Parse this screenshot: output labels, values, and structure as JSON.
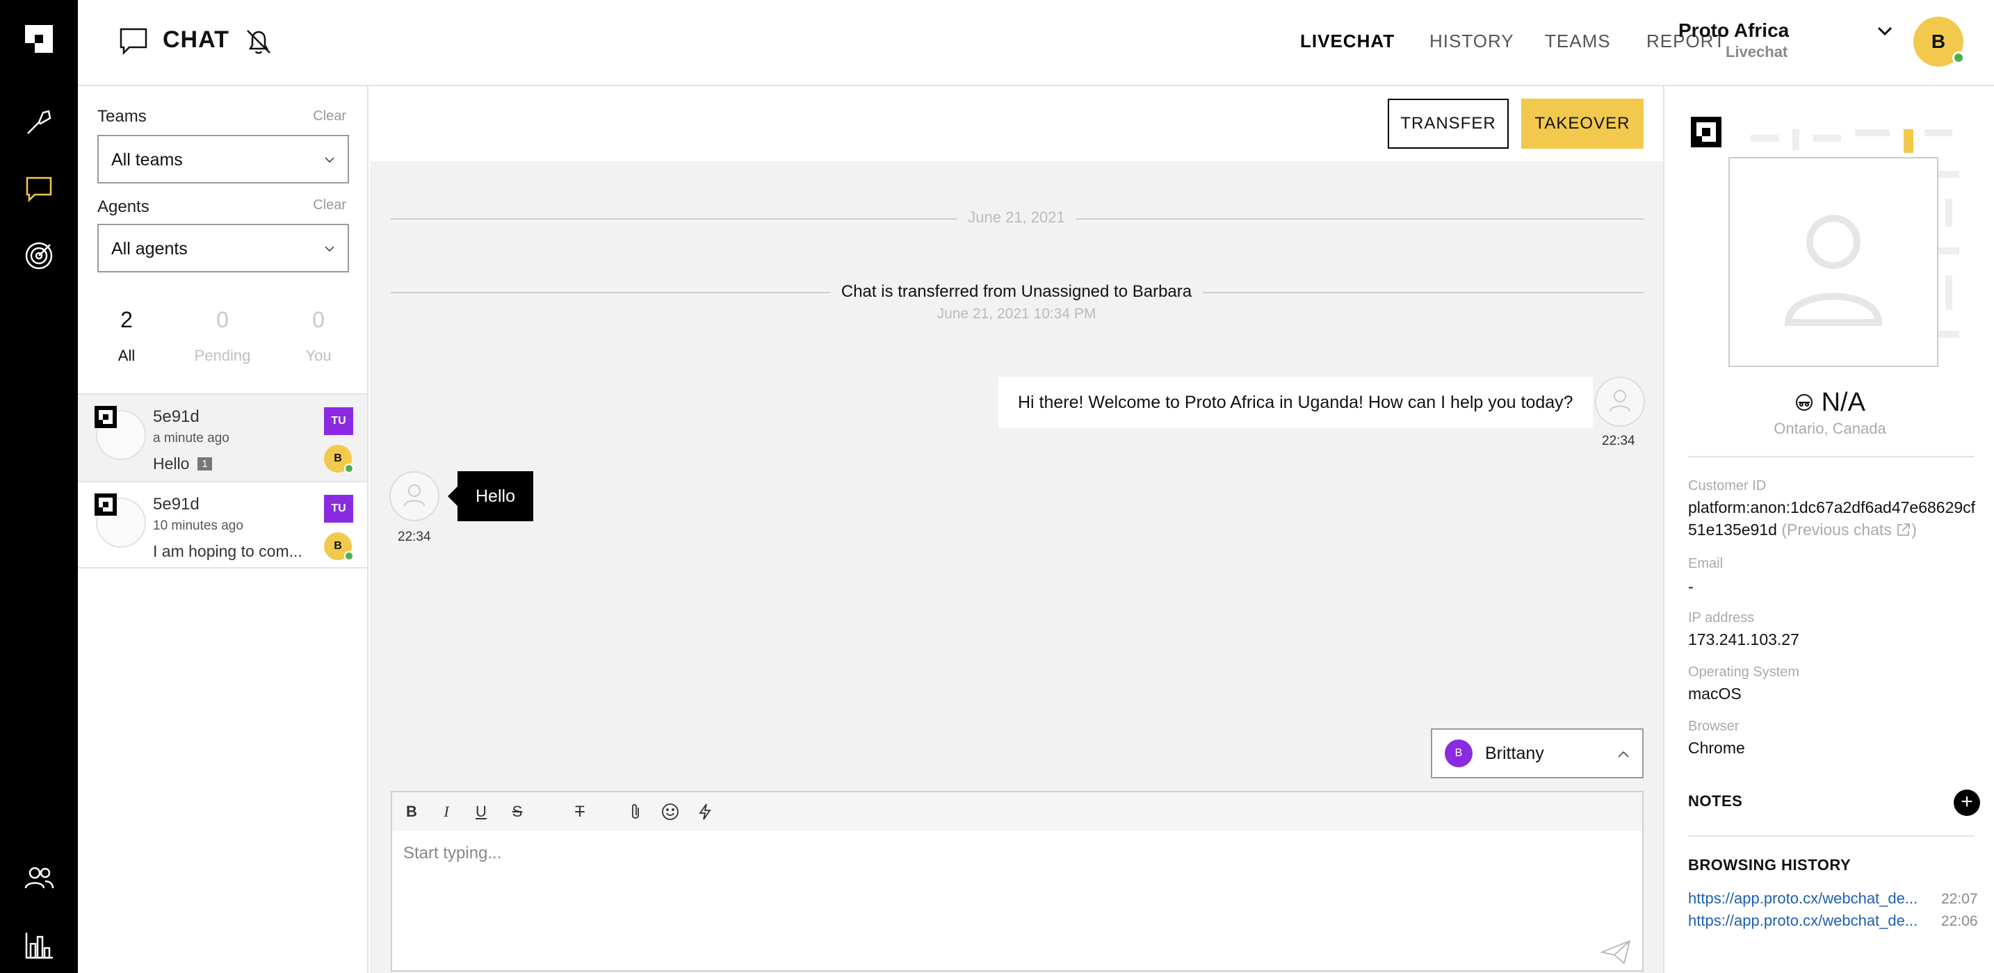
{
  "rail": {
    "icons": [
      "proto-logo-icon",
      "wrench-icon",
      "chat-bubble-icon",
      "target-icon",
      "users-icon",
      "bar-chart-icon"
    ],
    "active_color": "#f2c94c"
  },
  "header": {
    "title": "CHAT",
    "nav": [
      "LIVECHAT",
      "HISTORY",
      "TEAMS",
      "REPORT"
    ],
    "active_nav": "LIVECHAT",
    "brand": "Proto Africa",
    "brand_sub": "Livechat",
    "user_initial": "B"
  },
  "filters": {
    "teams_label": "Teams",
    "teams_clear": "Clear",
    "teams_value": "All teams",
    "agents_label": "Agents",
    "agents_clear": "Clear",
    "agents_value": "All agents",
    "counts": [
      {
        "num": "2",
        "label": "All"
      },
      {
        "num": "0",
        "label": "Pending"
      },
      {
        "num": "0",
        "label": "You"
      }
    ]
  },
  "conversations": [
    {
      "name": "5e91d",
      "time": "a minute ago",
      "message": "Hello",
      "unread": "1",
      "team": "TU",
      "agent": "B"
    },
    {
      "name": "5e91d",
      "time": "10 minutes ago",
      "message": "I am hoping to com...",
      "team": "TU",
      "agent": "B"
    }
  ],
  "chat": {
    "transfer_label": "TRANSFER",
    "takeover_label": "TAKEOVER",
    "date_divider": "June 21, 2021",
    "event_text": "Chat is transferred from Unassigned to Barbara",
    "event_time": "June 21, 2021 10:34 PM",
    "outgoing": {
      "text": "Hi there! Welcome to Proto Africa in Uganda! How can I help you today?",
      "time": "22:34"
    },
    "incoming": {
      "text": "Hello",
      "time": "22:34"
    },
    "agent_select": {
      "initial": "B",
      "name": "Brittany"
    },
    "composer_placeholder": "Start typing...",
    "accent": "#f2c94c"
  },
  "customer": {
    "name": "N/A",
    "location": "Ontario, Canada",
    "customer_id_label": "Customer ID",
    "customer_id": "platform:anon:1dc67a2df6ad47e68629cf51e135e91d",
    "previous_chats": "(Previous chats",
    "email_label": "Email",
    "email": "-",
    "ip_label": "IP address",
    "ip": "173.241.103.27",
    "os_label": "Operating System",
    "os": "macOS",
    "browser_label": "Browser",
    "browser": "Chrome",
    "notes_label": "NOTES",
    "history_label": "BROWSING HISTORY",
    "history": [
      {
        "url": "https://app.proto.cx/webchat_de...",
        "time": "22:07"
      },
      {
        "url": "https://app.proto.cx/webchat_de...",
        "time": "22:06"
      }
    ]
  }
}
